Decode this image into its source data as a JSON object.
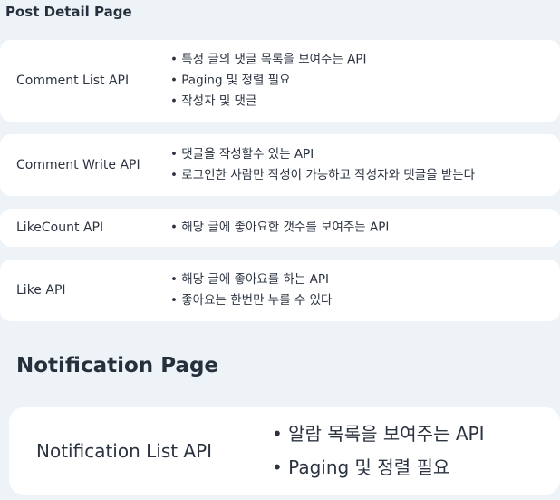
{
  "post_detail": {
    "title": "Post Detail Page",
    "apis": [
      {
        "name": "Comment List API",
        "bullets": [
          "특정 글의 댓글 목록을 보여주는 API",
          "Paging 및 정렬 필요",
          "작성자 및 댓글"
        ]
      },
      {
        "name": "Comment Write API",
        "bullets": [
          "댓글을 작성할수 있는 API",
          "로그인한 사람만 작성이 가능하고 작성자와 댓글을 받는다"
        ]
      },
      {
        "name": "LikeCount API",
        "bullets": [
          "해당 글에 좋아요한 갯수를 보여주는 API"
        ]
      },
      {
        "name": "Like API",
        "bullets": [
          "해당 글에 좋아요를 하는 API",
          "좋아요는 한번만 누를 수 있다"
        ]
      }
    ]
  },
  "notification": {
    "title": "Notification Page",
    "apis": [
      {
        "name": "Notification List API",
        "bullets": [
          "알람 목록을 보여주는 API",
          "Paging 및 정렬 필요"
        ]
      }
    ]
  }
}
